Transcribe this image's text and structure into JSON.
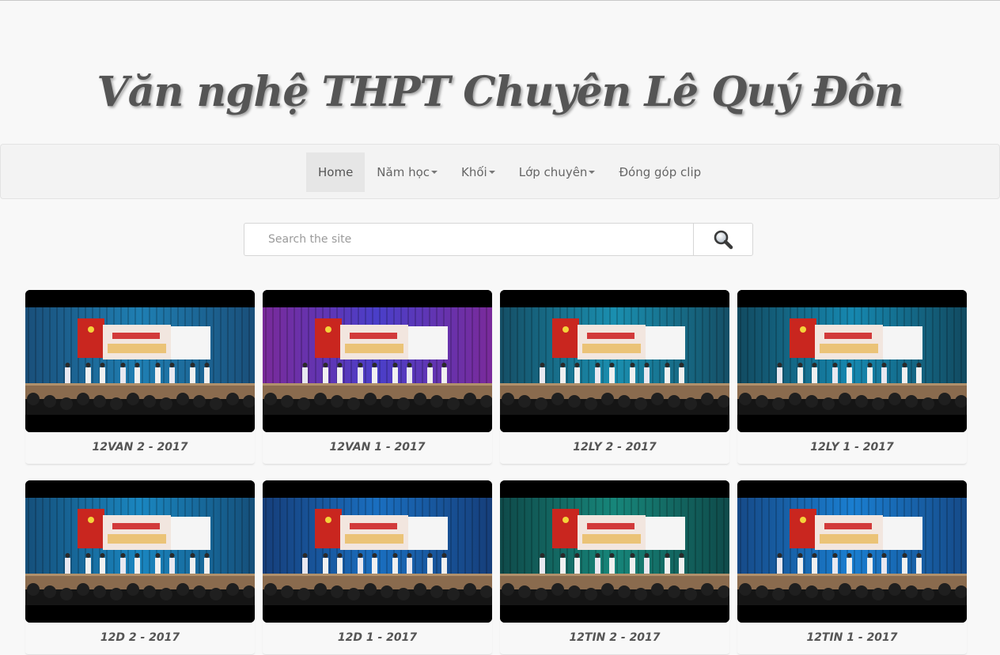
{
  "site": {
    "title": "Văn nghệ THPT Chuyên Lê Quý Đôn"
  },
  "nav": {
    "items": [
      {
        "label": "Home",
        "dropdown": false,
        "active": true
      },
      {
        "label": "Năm học",
        "dropdown": true,
        "active": false
      },
      {
        "label": "Khối",
        "dropdown": true,
        "active": false
      },
      {
        "label": "Lớp chuyên",
        "dropdown": true,
        "active": false
      },
      {
        "label": "Đóng góp clip",
        "dropdown": false,
        "active": false
      }
    ]
  },
  "search": {
    "placeholder": "Search the site",
    "icon": "magnifier-icon"
  },
  "videos": [
    {
      "title": "12VAN 2 - 2017",
      "curtain": "#1f7fb3",
      "tint": "#1a4f7a"
    },
    {
      "title": "12VAN 1 - 2017",
      "curtain": "#4a3fc9",
      "tint": "#7a2a9a"
    },
    {
      "title": "12LY 2 - 2017",
      "curtain": "#1a8fb0",
      "tint": "#154f66"
    },
    {
      "title": "12LY 1 - 2017",
      "curtain": "#1688b0",
      "tint": "#124a60"
    },
    {
      "title": "12D 2 - 2017",
      "curtain": "#1a86c0",
      "tint": "#154f7a"
    },
    {
      "title": "12D 1 - 2017",
      "curtain": "#1a6fc0",
      "tint": "#163e7a"
    },
    {
      "title": "12TIN 2 - 2017",
      "curtain": "#17867a",
      "tint": "#0f4a4a"
    },
    {
      "title": "12TIN 1 - 2017",
      "curtain": "#1a7ed0",
      "tint": "#164a88"
    }
  ]
}
